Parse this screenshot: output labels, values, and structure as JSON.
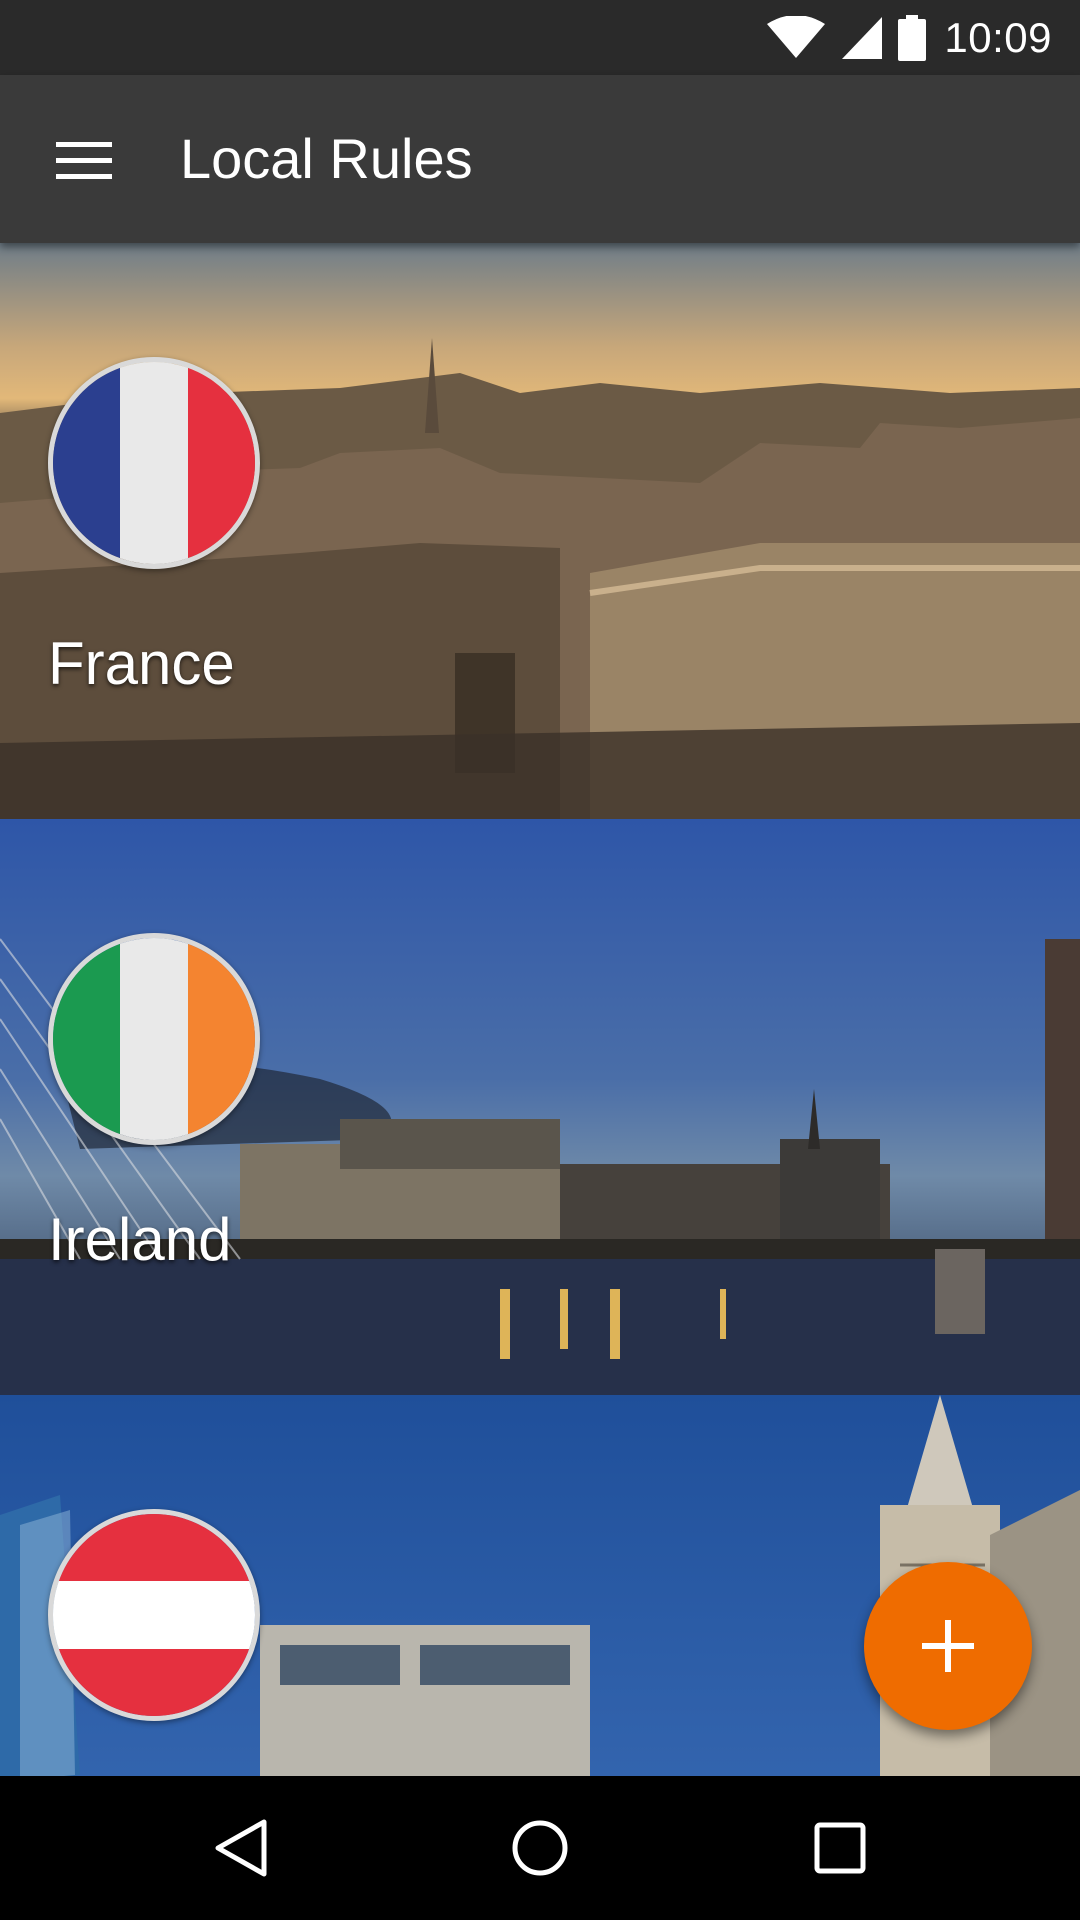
{
  "status_bar": {
    "time": "10:09",
    "icons": [
      "wifi-icon",
      "signal-icon",
      "battery-icon"
    ]
  },
  "app_bar": {
    "title": "Local Rules",
    "menu_icon": "hamburger-menu-icon"
  },
  "countries": [
    {
      "name": "France",
      "flag_colors": [
        "#2b3f8f",
        "#e9e9e9",
        "#e5303f"
      ],
      "flag_orientation": "vertical"
    },
    {
      "name": "Ireland",
      "flag_colors": [
        "#1b9a50",
        "#e9e9e9",
        "#f48430"
      ],
      "flag_orientation": "vertical"
    },
    {
      "name": "",
      "flag_colors": [
        "#e5303f",
        "#ffffff",
        "#e5303f"
      ],
      "flag_orientation": "horizontal"
    }
  ],
  "fab": {
    "icon": "plus-icon",
    "color": "#ef6c00"
  },
  "nav_bar": {
    "icons": [
      "back-icon",
      "home-icon",
      "recents-icon"
    ]
  }
}
